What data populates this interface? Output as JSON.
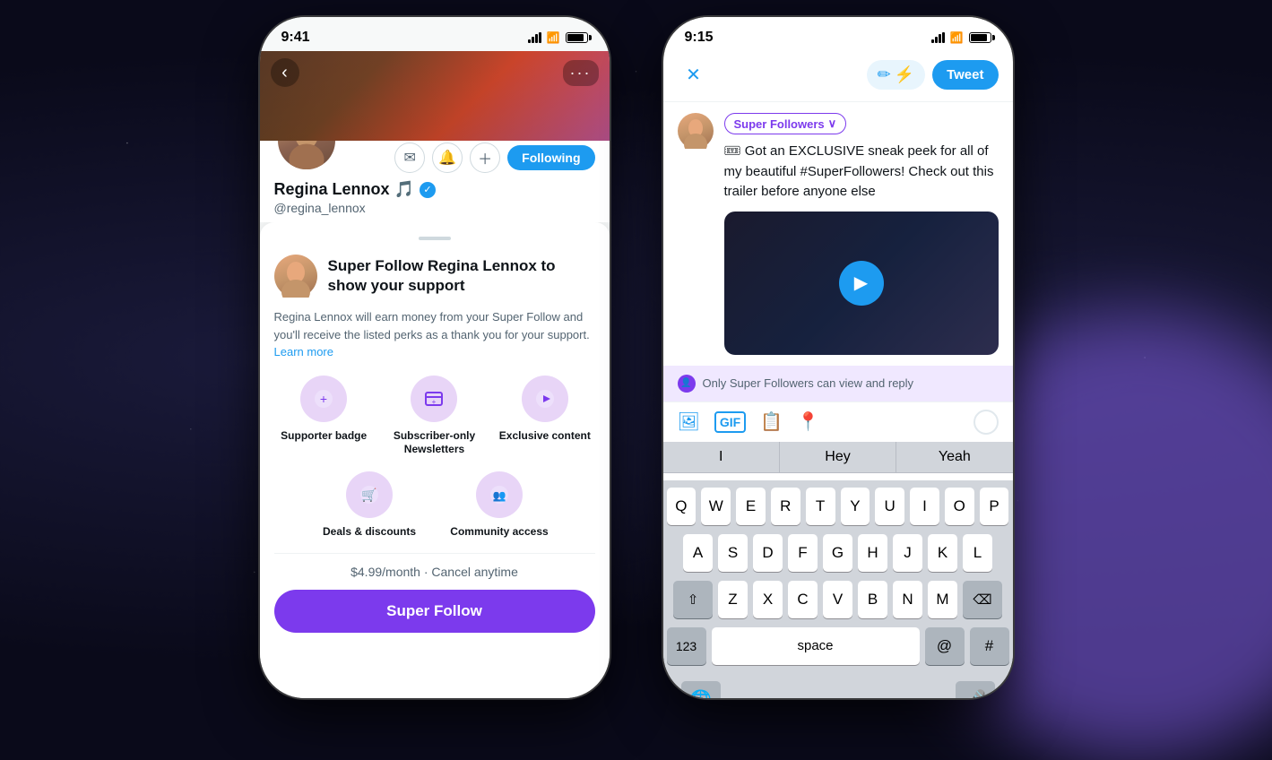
{
  "phone1": {
    "statusBar": {
      "time": "9:41",
      "icons": "signal wifi battery"
    },
    "profile": {
      "name": "Regina Lennox 🎵",
      "handle": "@regina_lennox",
      "verified": true,
      "followingLabel": "Following"
    },
    "sheet": {
      "title": "Super Follow Regina Lennox to show your support",
      "description": "Regina Lennox will earn money from your Super Follow and you'll receive the listed perks as a thank you for your support.",
      "learnMore": "Learn more",
      "perks": [
        {
          "label": "Supporter badge",
          "icon": "➕"
        },
        {
          "label": "Subscriber-only Newsletters",
          "icon": "📋"
        },
        {
          "label": "Exclusive content",
          "icon": "▶️"
        },
        {
          "label": "Deals & discounts",
          "icon": "🛒"
        },
        {
          "label": "Community access",
          "icon": "👥"
        }
      ],
      "price": "$4.99/month · Cancel anytime",
      "buttonLabel": "Super Follow"
    }
  },
  "phone2": {
    "statusBar": {
      "time": "9:15"
    },
    "header": {
      "closeIcon": "✕",
      "draftIcon": "✏",
      "tweetLabel": "Tweet"
    },
    "compose": {
      "audienceLabel": "Super Followers",
      "tweetText": "🎟 Got an EXCLUSIVE sneak peek for all of my beautiful #SuperFollowers! Check out this trailer before anyone else",
      "noticeText": "Only Super Followers can view and reply"
    },
    "suggestions": [
      "I",
      "Hey",
      "Yeah"
    ],
    "keyboard": {
      "row1": [
        "Q",
        "W",
        "E",
        "R",
        "T",
        "Y",
        "U",
        "I",
        "O",
        "P"
      ],
      "row2": [
        "A",
        "S",
        "D",
        "F",
        "G",
        "H",
        "J",
        "K",
        "L"
      ],
      "row3": [
        "Z",
        "X",
        "C",
        "V",
        "B",
        "N",
        "M"
      ],
      "bottomLeft": "123",
      "space": "space",
      "at": "@",
      "hash": "#"
    }
  }
}
